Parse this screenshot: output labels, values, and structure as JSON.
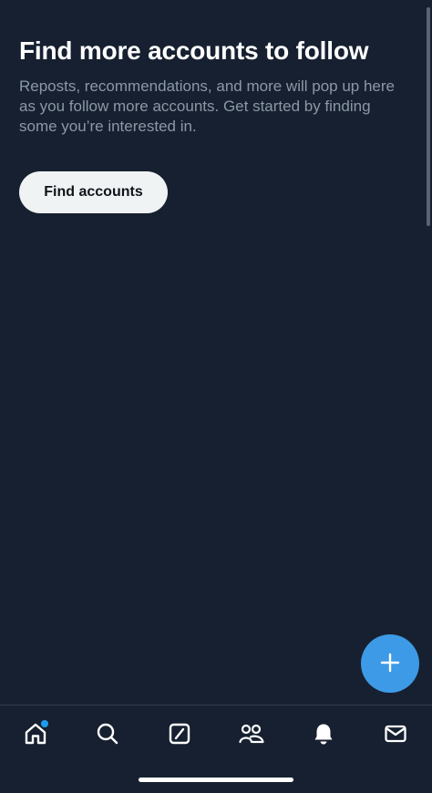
{
  "empty_state": {
    "title": "Find more accounts to follow",
    "subtitle": "Reposts, recommendations, and more will pop up here as you follow more accounts. Get started by finding some you’re interested in.",
    "button_label": "Find accounts"
  },
  "fab": {
    "icon": "plus-icon",
    "color": "#3d9ae6"
  },
  "tabbar": {
    "items": [
      {
        "icon": "home-icon",
        "active": true,
        "has_notification_dot": true
      },
      {
        "icon": "search-icon"
      },
      {
        "icon": "grok-icon"
      },
      {
        "icon": "communities-icon"
      },
      {
        "icon": "bell-icon"
      },
      {
        "icon": "mail-icon"
      }
    ]
  },
  "colors": {
    "background": "#172030",
    "title": "#ffffff",
    "subtitle": "#8b98a5",
    "button_bg": "#eff3f4",
    "accent": "#1d9bf0"
  }
}
